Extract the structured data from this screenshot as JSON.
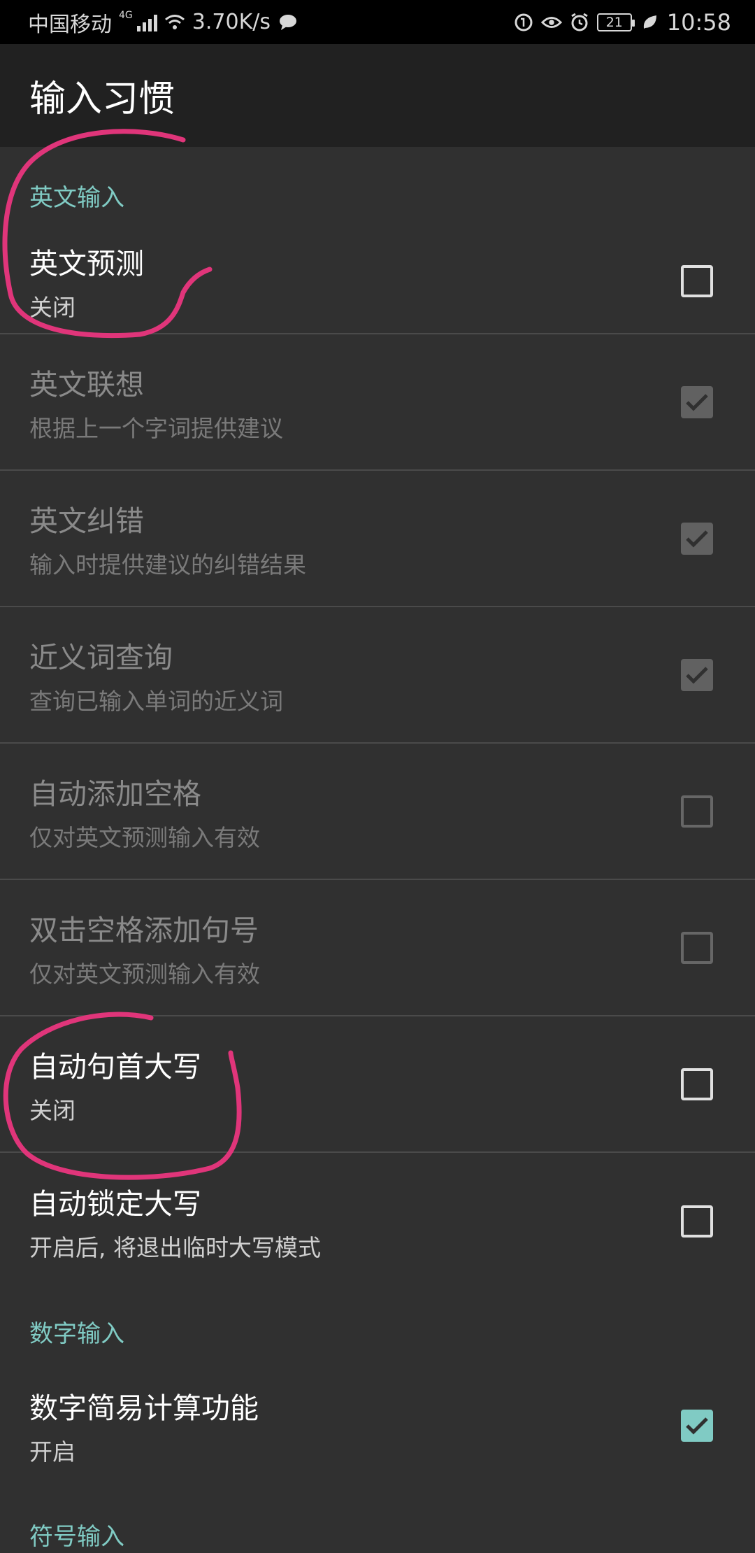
{
  "status_bar": {
    "carrier": "中国移动",
    "network": "4G",
    "speed": "3.70K/s",
    "battery": "21",
    "time": "10:58",
    "icons": [
      "signal-icon",
      "wifi-icon",
      "message-icon",
      "data-saver-icon",
      "eye-icon",
      "alarm-icon",
      "battery-icon",
      "leaf-icon"
    ]
  },
  "header": {
    "title": "输入习惯"
  },
  "sections": {
    "english": {
      "label": "英文输入"
    },
    "digits": {
      "label": "数字输入"
    },
    "symbols": {
      "label": "符号输入"
    }
  },
  "items": [
    {
      "title": "英文预测",
      "subtitle": "关闭",
      "checked": false,
      "enabled": true
    },
    {
      "title": "英文联想",
      "subtitle": "根据上一个字词提供建议",
      "checked": true,
      "enabled": false
    },
    {
      "title": "英文纠错",
      "subtitle": "输入时提供建议的纠错结果",
      "checked": true,
      "enabled": false
    },
    {
      "title": "近义词查询",
      "subtitle": "查询已输入单词的近义词",
      "checked": true,
      "enabled": false
    },
    {
      "title": "自动添加空格",
      "subtitle": "仅对英文预测输入有效",
      "checked": false,
      "enabled": false
    },
    {
      "title": "双击空格添加句号",
      "subtitle": "仅对英文预测输入有效",
      "checked": false,
      "enabled": false
    },
    {
      "title": "自动句首大写",
      "subtitle": "关闭",
      "checked": false,
      "enabled": true
    },
    {
      "title": "自动锁定大写",
      "subtitle": "开启后, 将退出临时大写模式",
      "checked": false,
      "enabled": true
    },
    {
      "title": "数字简易计算功能",
      "subtitle": "开启",
      "checked": true,
      "enabled": true
    }
  ],
  "colors": {
    "accent": "#80cbc4",
    "annotation": "#e0357a",
    "background": "#303030",
    "toolbar": "#212121"
  }
}
